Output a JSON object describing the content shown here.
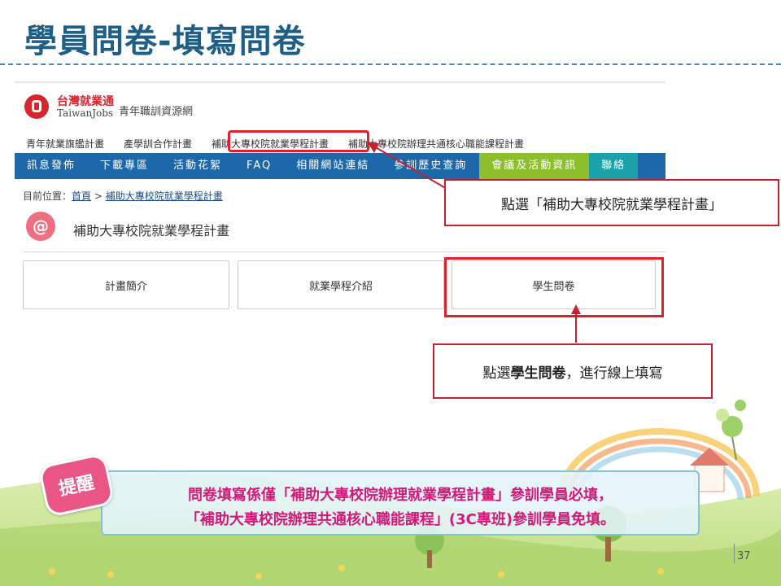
{
  "slide": {
    "title": "學員問卷-填寫問卷",
    "page_number": "37"
  },
  "site": {
    "logo_name": "台灣就業通",
    "logo_sub": "TaiwanJobs",
    "site_name": "青年職訓資源網",
    "subnav": [
      "青年就業旗艦計畫",
      "產學訓合作計畫",
      "補助大專校院就業學程計畫",
      "補助大專校院辦理共通核心職能課程計畫"
    ],
    "mainnav": [
      "訊息發佈",
      "下載專區",
      "活動花絮",
      "FAQ",
      "相關網站連結",
      "參訓歷史查詢",
      "會議及活動資訊",
      "聯絡"
    ],
    "breadcrumb": {
      "prefix": "目前位置：",
      "home": "首頁",
      "separator": " > ",
      "current": "補助大專校院就業學程計畫"
    },
    "section_icon": "@",
    "section_title": "補助大專校院就業學程計畫",
    "cards": [
      "計畫簡介",
      "就業學程介紹",
      "學生問卷"
    ]
  },
  "callouts": {
    "c1": "點選「補助大專校院就業學程計畫」",
    "c2_prefix": "點選",
    "c2_bold": "學生問卷",
    "c2_suffix": "，進行線上填寫"
  },
  "reminder": {
    "badge": "提醒",
    "line1": "問卷填寫係僅「補助大專校院辦理就業學程計畫」參訓學員必填，",
    "line2": "「補助大專校院辦理共通核心職能課程」(3C專班)參訓學員免填。"
  },
  "colors": {
    "title": "#1f5f86",
    "nav": "#1e67a8",
    "nav_green": "#8dbe2c",
    "highlight": "#e0202a",
    "reminder_text": "#d21a78"
  }
}
